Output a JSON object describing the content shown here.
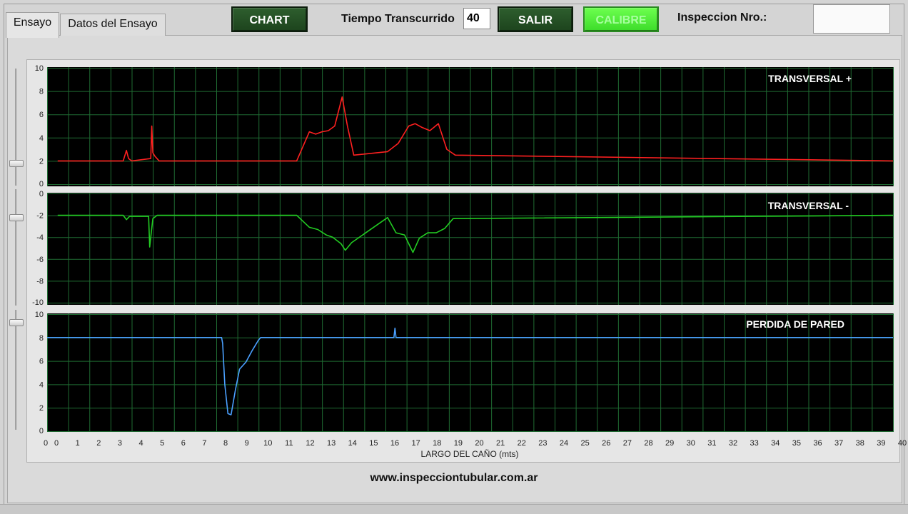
{
  "tabs": {
    "ensayo": "Ensayo",
    "datos": "Datos del Ensayo"
  },
  "toolbar": {
    "chart_label": "CHART",
    "tiempo_label": "Tiempo Transcurrido",
    "tiempo_value": "40",
    "salir_label": "SALIR",
    "calibre_label": "CALIBRE",
    "inspeccion_label": "Inspeccion Nro.:",
    "inspeccion_value": ""
  },
  "footer": {
    "url": "www.inspecciontubular.com.ar"
  },
  "colors": {
    "graph_bg": "#000000",
    "grid": "#1f6b32",
    "plot1": "#ff2020",
    "plot2": "#22cc22",
    "plot3": "#4aa0ff"
  },
  "chart_data": {
    "type": "line",
    "x_axis": {
      "label": "LARGO DEL CAÑO (mts)",
      "range": [
        0,
        40
      ],
      "ticks": [
        "0",
        "0",
        "1",
        "2",
        "3",
        "4",
        "5",
        "6",
        "7",
        "8",
        "9",
        "10",
        "11",
        "12",
        "13",
        "14",
        "15",
        "16",
        "17",
        "18",
        "19",
        "20",
        "21",
        "22",
        "23",
        "24",
        "25",
        "26",
        "27",
        "28",
        "29",
        "30",
        "31",
        "32",
        "33",
        "34",
        "35",
        "36",
        "37",
        "38",
        "39",
        "40"
      ]
    },
    "grid": true,
    "plots": [
      {
        "title": "TRANSVERSAL +",
        "ylim": [
          0,
          10
        ],
        "yticks": [
          "10",
          "8",
          "6",
          "4",
          "2",
          "0"
        ],
        "baseline": 2,
        "x": [
          0.5,
          3.6,
          3.75,
          3.85,
          4.0,
          4.9,
          4.95,
          5.0,
          5.1,
          5.3,
          11.8,
          12.4,
          12.7,
          13.0,
          13.3,
          13.6,
          13.95,
          14.2,
          14.5,
          16.1,
          16.6,
          17.1,
          17.4,
          17.7,
          18.1,
          18.5,
          18.9,
          19.3,
          40
        ],
        "y": [
          2,
          2,
          2.9,
          2.2,
          2,
          2.2,
          5.0,
          2.7,
          2.4,
          2,
          2,
          4.5,
          4.3,
          4.5,
          4.6,
          5.0,
          7.5,
          5.0,
          2.5,
          2.8,
          3.5,
          5.0,
          5.2,
          4.9,
          4.6,
          5.2,
          3.0,
          2.5,
          2
        ]
      },
      {
        "title": "TRANSVERSAL -",
        "ylim": [
          -10,
          0
        ],
        "yticks": [
          "0",
          "-2",
          "-4",
          "-6",
          "-8",
          "-10"
        ],
        "baseline": -2,
        "x": [
          0.5,
          3.6,
          3.75,
          3.9,
          4.8,
          4.85,
          5.0,
          5.2,
          11.8,
          12.4,
          12.8,
          13.2,
          13.5,
          13.9,
          14.1,
          14.4,
          16.1,
          16.5,
          16.9,
          17.3,
          17.6,
          18.0,
          18.4,
          18.8,
          19.2,
          40
        ],
        "y": [
          -2,
          -2,
          -2.4,
          -2.1,
          -2.1,
          -4.9,
          -2.3,
          -2,
          -2,
          -3.1,
          -3.3,
          -3.8,
          -4.0,
          -4.6,
          -5.2,
          -4.5,
          -2.2,
          -3.6,
          -3.8,
          -5.4,
          -4.1,
          -3.6,
          -3.6,
          -3.2,
          -2.3,
          -2
        ]
      },
      {
        "title": "PERDIDA DE PARED",
        "ylim": [
          0,
          10
        ],
        "yticks": [
          "10",
          "8",
          "6",
          "4",
          "2",
          "0"
        ],
        "baseline": 8,
        "x": [
          0,
          8.25,
          8.3,
          8.4,
          8.55,
          8.7,
          8.9,
          9.1,
          9.4,
          9.7,
          10.0,
          10.1,
          16.4,
          16.45,
          16.5,
          40
        ],
        "y": [
          8,
          8,
          7.5,
          4.0,
          1.5,
          1.4,
          3.5,
          5.3,
          5.9,
          6.9,
          7.8,
          8,
          8,
          8.8,
          8,
          8
        ]
      }
    ]
  }
}
